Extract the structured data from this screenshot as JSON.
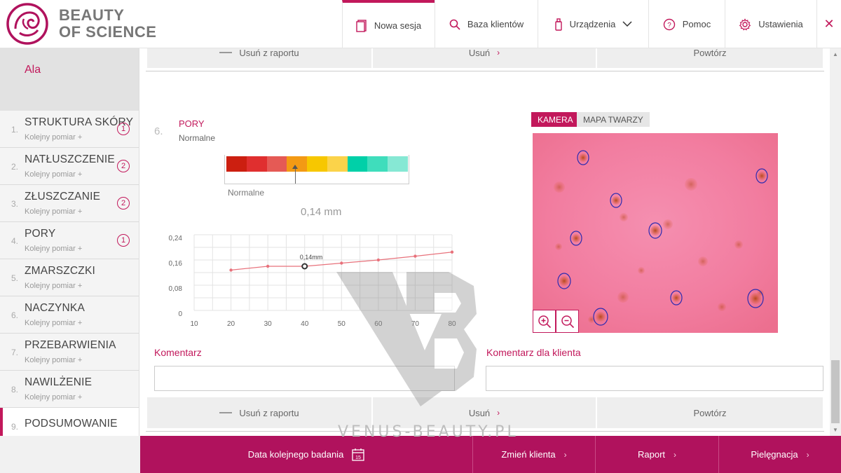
{
  "brand": {
    "line1": "BEAUTY",
    "line2": "OF SCIENCE"
  },
  "nav": [
    {
      "label": "Nowa sesja",
      "icon": "document-icon"
    },
    {
      "label": "Baza klientów",
      "icon": "search-icon"
    },
    {
      "label": "Urządzenia",
      "icon": "device-icon"
    },
    {
      "label": "Pomoc",
      "icon": "help-icon"
    },
    {
      "label": "Ustawienia",
      "icon": "gear-icon"
    }
  ],
  "close_glyph": "✕",
  "client_name": "Ala",
  "steps": [
    {
      "num": "1.",
      "title": "STRUKTURA SKÓRY",
      "sub": "Kolejny pomiar +",
      "badge": "1"
    },
    {
      "num": "2.",
      "title": "NATŁUSZCZENIE",
      "sub": "Kolejny pomiar +",
      "badge": "2"
    },
    {
      "num": "3.",
      "title": "ZŁUSZCZANIE",
      "sub": "Kolejny pomiar +",
      "badge": "2"
    },
    {
      "num": "4.",
      "title": "PORY",
      "sub": "Kolejny pomiar +",
      "badge": "1"
    },
    {
      "num": "5.",
      "title": "ZMARSZCZKI",
      "sub": "Kolejny pomiar +",
      "badge": ""
    },
    {
      "num": "6.",
      "title": "NACZYNKA",
      "sub": "Kolejny pomiar +",
      "badge": ""
    },
    {
      "num": "7.",
      "title": "PRZEBARWIENIA",
      "sub": "Kolejny pomiar +",
      "badge": ""
    },
    {
      "num": "8.",
      "title": "NAWILŻENIE",
      "sub": "Kolejny pomiar +",
      "badge": ""
    },
    {
      "num": "9.",
      "title": "PODSUMOWANIE",
      "sub": "",
      "badge": ""
    }
  ],
  "actions": {
    "remove": "Usuń z raportu",
    "remove_top": "Usuń z raportu",
    "delete": "Usuń",
    "repeat": "Powtórz"
  },
  "section": {
    "num": "6.",
    "title": "PORY",
    "subtitle": "Normalne",
    "scale_label": "Normalne",
    "value": "0,14 mm",
    "scale_colors": [
      "#cc1f10",
      "#e02f2f",
      "#e55a55",
      "#f39a14",
      "#f7c700",
      "#fbd34a",
      "#00d0a8",
      "#3fddbc",
      "#86e8d4"
    ],
    "scale_position": 0.38
  },
  "chart_data": {
    "type": "line",
    "x": [
      20,
      30,
      40,
      50,
      60,
      70,
      80
    ],
    "values": [
      0.128,
      0.14,
      0.14,
      0.15,
      0.16,
      0.172,
      0.185
    ],
    "y_ticks": [
      "0,24",
      "0,16",
      "0,08",
      "0"
    ],
    "x_ticks": [
      "10",
      "20",
      "30",
      "40",
      "50",
      "60",
      "70",
      "80"
    ],
    "xlim": [
      10,
      80
    ],
    "ylim": [
      0,
      0.24
    ],
    "highlight_index": 2,
    "highlight_label": "0,14mm",
    "grid": true,
    "color": "#e8717b"
  },
  "camera": {
    "tab_on": "KAMERA",
    "tab_off": "MAPA TWARZY"
  },
  "comments": {
    "left": "Komentarz",
    "right": "Komentarz dla klienta"
  },
  "footer": {
    "next_exam": "Data kolejnego badania",
    "calendar_day": "15",
    "change_client": "Zmień klienta",
    "report": "Raport",
    "care": "Pielęgnacja"
  },
  "watermark": "VENUS-BEAUTY.PL"
}
